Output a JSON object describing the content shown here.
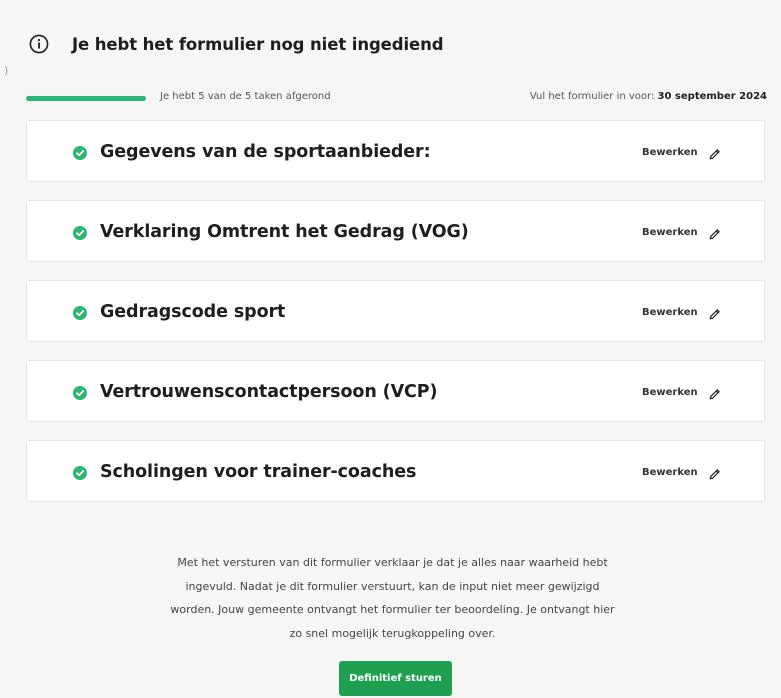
{
  "header": {
    "icon": "info-icon",
    "title": "Je hebt het formulier nog niet ingediend"
  },
  "progress": {
    "text": "Je hebt 5 van de 5 taken afgerond",
    "completed": 5,
    "total": 5,
    "fraction": 1.0,
    "color": "#2bb673"
  },
  "deadline": {
    "label": "Vul het formulier in voor:",
    "date": "30 september 2024"
  },
  "tasks": [
    {
      "title": "Gegevens van de sportaanbieder:",
      "edit_label": "Bewerken",
      "status": "completed"
    },
    {
      "title": "Verklaring Omtrent het Gedrag (VOG)",
      "edit_label": "Bewerken",
      "status": "completed"
    },
    {
      "title": "Gedragscode sport",
      "edit_label": "Bewerken",
      "status": "completed"
    },
    {
      "title": "Vertrouwenscontactpersoon (VCP)",
      "edit_label": "Bewerken",
      "status": "completed"
    },
    {
      "title": "Scholingen voor trainer-coaches",
      "edit_label": "Bewerken",
      "status": "completed"
    }
  ],
  "declaration": {
    "line1": "Met het versturen van dit formulier verklaar je dat je alles naar waarheid hebt",
    "line2": "ingevuld. Nadat je dit formulier verstuurt, kan de input niet meer gewijzigd",
    "line3": "worden. Jouw gemeente ontvangt het formulier ter beoordeling. Je ontvangt hier",
    "line4": "zo snel mogelijk terugkoppeling over."
  },
  "submit": {
    "label": "Definitief sturen",
    "color": "#1f9f50"
  },
  "colors": {
    "check": "#2bb673",
    "background": "#f6f6f6",
    "card": "#ffffff"
  }
}
